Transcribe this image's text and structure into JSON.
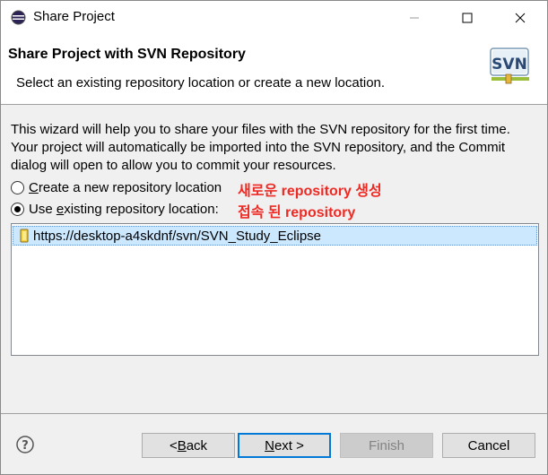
{
  "window": {
    "title": "Share Project",
    "icon": "eclipse-icon"
  },
  "banner": {
    "title": "Share Project with SVN Repository",
    "description": "Select an existing repository location or create a new location.",
    "logo_text": "SVN"
  },
  "intro_lines": [
    "This wizard will help you to share your files with the SVN repository for the first time.",
    "Your project will automatically be imported into the SVN repository, and the Commit",
    "dialog will open to allow you to commit your resources."
  ],
  "options": {
    "create_new": {
      "prefix": "",
      "mnemonic": "C",
      "rest": "reate a new repository location",
      "selected": false
    },
    "use_existing": {
      "prefix": "Use ",
      "mnemonic": "e",
      "rest": "xisting repository location:",
      "selected": true
    }
  },
  "annotations": {
    "create_new": "새로운 repository 생성",
    "use_existing": "접속 된 repository"
  },
  "repositories": [
    {
      "url": "https://desktop-a4skdnf/svn/SVN_Study_Eclipse",
      "selected": true
    }
  ],
  "buttons": {
    "back": {
      "prefix": "< ",
      "mnemonic": "B",
      "rest": "ack"
    },
    "next": {
      "prefix": "",
      "mnemonic": "N",
      "rest": "ext >"
    },
    "finish": {
      "label": "Finish",
      "disabled": true
    },
    "cancel": {
      "label": "Cancel"
    }
  },
  "colors": {
    "annotation": "#ee2a24",
    "selection": "#cce8ff",
    "default_button_border": "#0078d7"
  }
}
